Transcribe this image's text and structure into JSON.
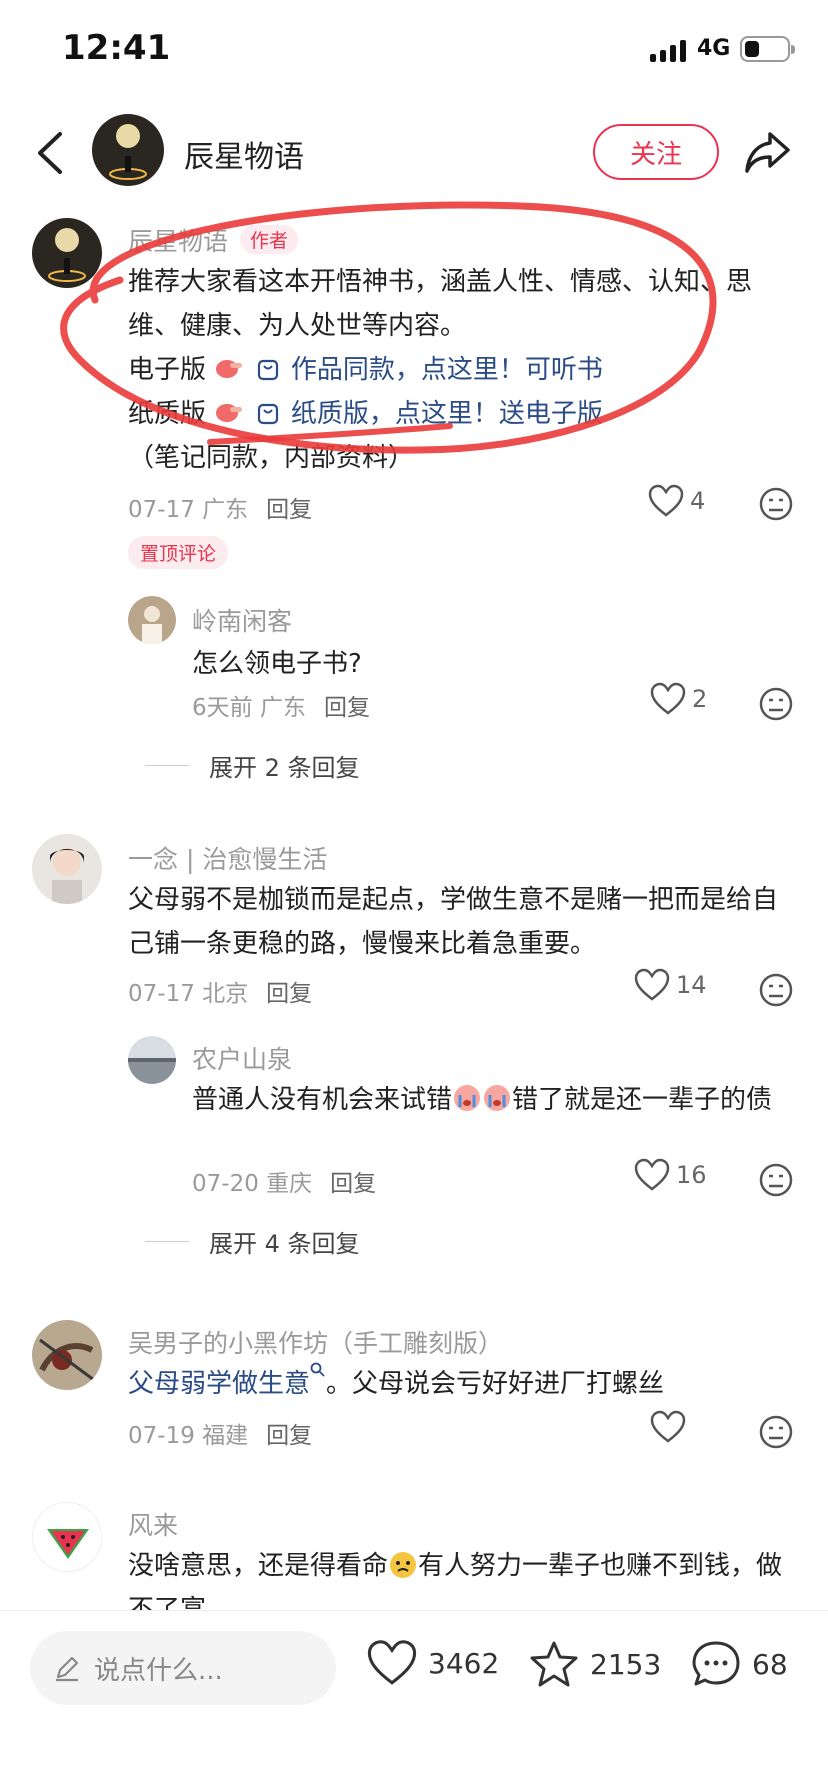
{
  "status": {
    "time": "12:41",
    "network": "4G"
  },
  "header": {
    "title": "辰星物语",
    "follow_label": "关注"
  },
  "colors": {
    "accent": "#e8344e",
    "link": "#2b4c86"
  },
  "comments": [
    {
      "name": "辰星物语",
      "tag": "作者",
      "line1": "推荐大家看这本开悟神书，涵盖人性、情感、认知、思维、健康、为人处世等内容。",
      "line2_prefix": "电子版",
      "line2_link": "作品同款，点这里！可听书",
      "line3_prefix": "纸质版",
      "line3_link": "纸质版，点这里！送电子版",
      "line4": "（笔记同款，内部资料）",
      "date": "07-17",
      "location": "广东",
      "reply": "回复",
      "likes": "4",
      "pinned": "置顶评论",
      "sub": {
        "name": "岭南闲客",
        "text": "怎么领电子书?",
        "date": "6天前",
        "location": "广东",
        "reply": "回复",
        "likes": "2"
      },
      "expand": "展开 2 条回复"
    },
    {
      "name": "一念 | 治愈慢生活",
      "text": "父母弱不是枷锁而是起点，学做生意不是赌一把而是给自己铺一条更稳的路，慢慢来比着急重要。",
      "date": "07-17",
      "location": "北京",
      "reply": "回复",
      "likes": "14",
      "sub": {
        "name": "农户山泉",
        "text_a": "普通人没有机会来试错",
        "text_b": "错了就是还一辈子的债",
        "date": "07-20",
        "location": "重庆",
        "reply": "回复",
        "likes": "16"
      },
      "expand": "展开 4 条回复"
    },
    {
      "name": "吴男子的小黑作坊（手工雕刻版）",
      "link": "父母弱学做生意",
      "text": "。父母说会亏好好进厂打螺丝",
      "date": "07-19",
      "location": "福建",
      "reply": "回复"
    },
    {
      "name": "风来",
      "text_a": "没啥意思，还是得看命",
      "text_b": "有人努力一辈子也赚不到钱，做不了富",
      "icon": "watermelon-icon"
    }
  ],
  "bottom": {
    "placeholder": "说点什么...",
    "likes": "3462",
    "stars": "2153",
    "comments": "68"
  }
}
